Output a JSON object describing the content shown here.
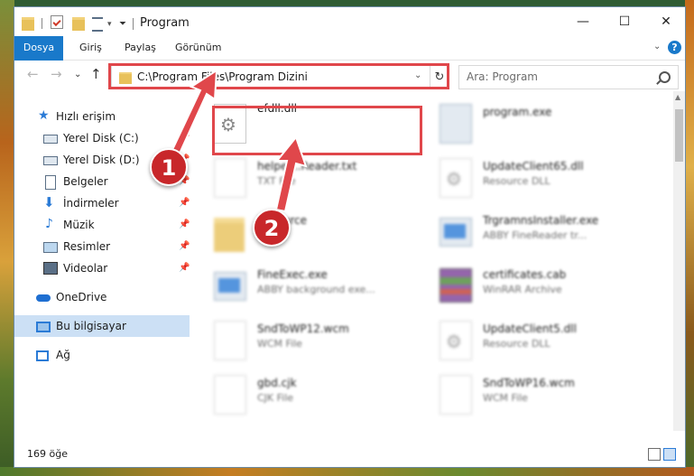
{
  "window": {
    "title": "Program",
    "controls": {
      "minimize": "—",
      "maximize": "☐",
      "close": "✕"
    }
  },
  "ribbon": {
    "tabs": [
      "Dosya",
      "Giriş",
      "Paylaş",
      "Görünüm"
    ],
    "help": "?"
  },
  "address": {
    "path": "C:\\Program Files\\Program Dizini",
    "search_placeholder": "Ara: Program"
  },
  "sidebar": {
    "items": [
      {
        "label": "Hızlı erişim",
        "icon": "star-icon"
      },
      {
        "label": "Yerel Disk (C:)",
        "icon": "drive-icon",
        "pinned": true
      },
      {
        "label": "Yerel Disk (D:)",
        "icon": "drive-icon",
        "pinned": true
      },
      {
        "label": "Belgeler",
        "icon": "documents-icon",
        "pinned": true
      },
      {
        "label": "İndirmeler",
        "icon": "download-icon",
        "pinned": true
      },
      {
        "label": "Müzik",
        "icon": "music-icon",
        "pinned": true
      },
      {
        "label": "Resimler",
        "icon": "pictures-icon",
        "pinned": true
      },
      {
        "label": "Videolar",
        "icon": "videos-icon",
        "pinned": true
      },
      {
        "label": "OneDrive",
        "icon": "onedrive-icon"
      },
      {
        "label": "Bu bilgisayar",
        "icon": "computer-icon",
        "selected": true
      },
      {
        "label": "Ağ",
        "icon": "network-icon"
      }
    ]
  },
  "files": [
    {
      "name": "efdll.dll",
      "sub": "",
      "icon": "settings-file-icon",
      "highlighted": true
    },
    {
      "name": "program.exe",
      "sub": "",
      "icon": "program-icon"
    },
    {
      "name": "helper...Reader.txt",
      "sub": "TXT File",
      "icon": "text-file-icon"
    },
    {
      "name": "UpdateClient65.dll",
      "sub": "Resource DLL",
      "icon": "dll-icon"
    },
    {
      "name": "Resource",
      "sub": "",
      "icon": "folder-icon"
    },
    {
      "name": "TrgramnsInstaller.exe",
      "sub": "ABBY FineReader tr...",
      "icon": "exe-icon"
    },
    {
      "name": "FineExec.exe",
      "sub": "ABBY background exe...",
      "icon": "exe-icon"
    },
    {
      "name": "certificates.cab",
      "sub": "WinRAR Archive",
      "icon": "archive-icon"
    },
    {
      "name": "SndToWP12.wcm",
      "sub": "WCM File",
      "icon": "generic-file-icon"
    },
    {
      "name": "UpdateClient5.dll",
      "sub": "Resource DLL",
      "icon": "dll-icon"
    },
    {
      "name": "gbd.cjk",
      "sub": "CJK File",
      "icon": "generic-file-icon"
    },
    {
      "name": "SndToWP16.wcm",
      "sub": "WCM File",
      "icon": "generic-file-icon"
    }
  ],
  "status": {
    "count": "169 öğe"
  },
  "annotations": {
    "badge1": "1",
    "badge2": "2"
  },
  "colors": {
    "accent": "#1979ca",
    "highlight": "#e0474b",
    "badge": "#c8272a"
  }
}
